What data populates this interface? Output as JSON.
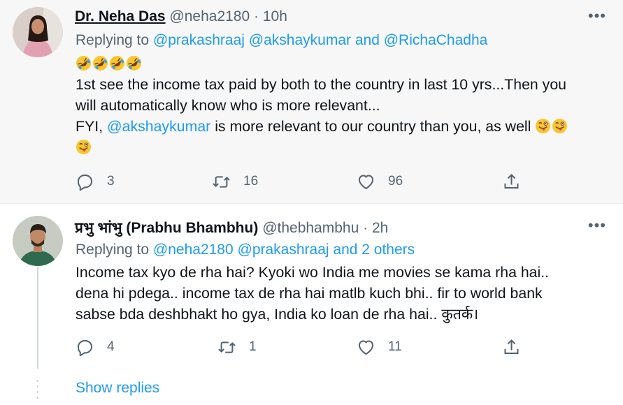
{
  "tweets": [
    {
      "display_name": "Dr. Neha Das",
      "handle": "@neha2180",
      "separator": "·",
      "time": "10h",
      "replying_label": "Replying to",
      "replying_mentions": [
        "@prakashraaj",
        "@akshaykumar"
      ],
      "replying_and": "and",
      "replying_last": "@RichaChadha",
      "emoji_line": [
        "rolling-laughing-emoji",
        "rolling-laughing-emoji",
        "rolling-laughing-emoji",
        "rolling-laughing-emoji"
      ],
      "text_line1": "1st see the income tax paid by both to the country in last 10 yrs...Then you",
      "text_line2": "will automatically know who is more relevant...",
      "text_line3_pre": "FYI,",
      "text_line3_mention": "@akshaykumar",
      "text_line3_post": "is more relevant to our country than you, as well",
      "trailing_emoji": [
        "winking-tongue-emoji",
        "winking-tongue-emoji",
        "winking-tongue-emoji"
      ],
      "replies": "3",
      "retweets": "16",
      "likes": "96"
    },
    {
      "display_name": "प्रभु भांभु (Prabhu Bhambhu)",
      "handle": "@thebhambhu",
      "separator": "·",
      "time": "2h",
      "replying_label": "Replying to",
      "replying_mentions": [
        "@neha2180",
        "@prakashraaj"
      ],
      "replying_and": "and 2 others",
      "text_line1": "Income tax kyo de rha hai? Kyoki wo India me movies se kama rha hai..",
      "text_line2": "dena hi pdega.. income tax de rha hai matlb kuch bhi.. fir to world bank",
      "text_line3": "sabse bda deshbhakt ho gya, India ko loan de rha hai.. कुतर्क।",
      "replies": "4",
      "retweets": "1",
      "likes": "11"
    }
  ],
  "more_icon": "more-horizontal-icon",
  "show_replies": "Show replies",
  "colors": {
    "link": "#1d9bf0",
    "secondary_text": "#536471",
    "primary_text": "#0f1419",
    "highlight_bg": "#f7f7f7"
  }
}
